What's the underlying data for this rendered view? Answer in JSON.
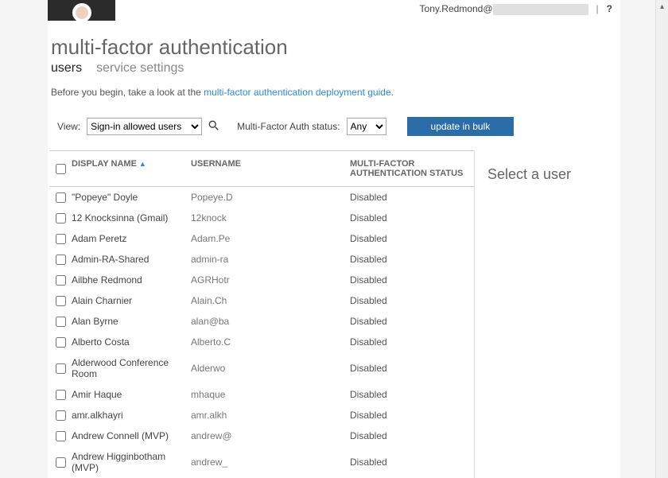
{
  "header": {
    "account_email_prefix": "Tony.Redmond@",
    "help_glyph": "?"
  },
  "page": {
    "title": "multi-factor authentication"
  },
  "tabs": [
    {
      "label": "users",
      "active": true
    },
    {
      "label": "service settings",
      "active": false
    }
  ],
  "intro": {
    "prefix": "Before you begin, take a look at the ",
    "link_text": "multi-factor authentication deployment guide",
    "suffix": "."
  },
  "controls": {
    "view_label": "View:",
    "view_value": "Sign-in allowed users",
    "search_icon": "search-icon",
    "status_label": "Multi-Factor Auth status:",
    "status_value": "Any",
    "bulk_button": "update in bulk"
  },
  "columns": {
    "name": "DISPLAY NAME",
    "username": "USERNAME",
    "status": "MULTI-FACTOR AUTHENTICATION STATUS"
  },
  "rows": [
    {
      "name": "\"Popeye\" Doyle",
      "username": "Popeye.D",
      "status": "Disabled"
    },
    {
      "name": "12 Knocksinna (Gmail)",
      "username": "12knock",
      "status": "Disabled"
    },
    {
      "name": "Adam Peretz",
      "username": "Adam.Pe",
      "status": "Disabled"
    },
    {
      "name": "Admin-RA-Shared",
      "username": "admin-ra",
      "status": "Disabled"
    },
    {
      "name": "Ailbhe Redmond",
      "username": "AGRHotr",
      "status": "Disabled"
    },
    {
      "name": "Alain Charnier",
      "username": "Alain.Ch",
      "status": "Disabled"
    },
    {
      "name": "Alan Byrne",
      "username": "alan@ba",
      "status": "Disabled"
    },
    {
      "name": "Alberto Costa",
      "username": "Alberto.C",
      "status": "Disabled"
    },
    {
      "name": "Alderwood Conference Room",
      "username": "Alderwo",
      "status": "Disabled"
    },
    {
      "name": "Amir Haque",
      "username": "mhaque",
      "status": "Disabled"
    },
    {
      "name": "amr.alkhayri",
      "username": "amr.alkh",
      "status": "Disabled"
    },
    {
      "name": "Andrew Connell (MVP)",
      "username": "andrew@",
      "status": "Disabled"
    },
    {
      "name": "Andrew Higginbotham (MVP)",
      "username": "andrew_",
      "status": "Disabled"
    }
  ],
  "side_panel": {
    "title": "Select a user"
  }
}
